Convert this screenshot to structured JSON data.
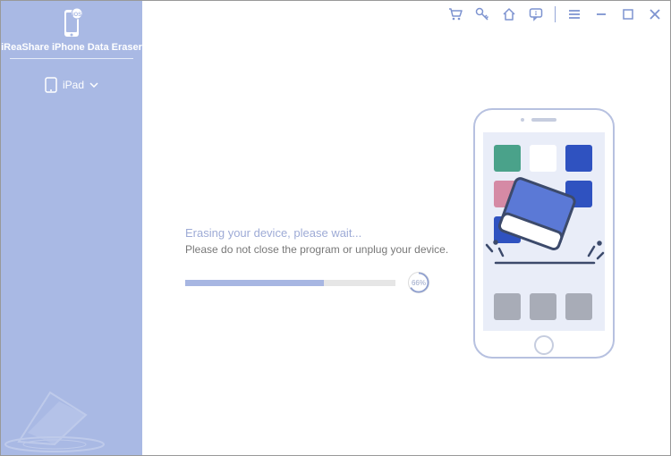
{
  "app": {
    "brand": "iReaShare iPhone Data Eraser"
  },
  "sidebar": {
    "device_label": "iPad"
  },
  "titlebar": {
    "icons": {
      "cart": "cart-icon",
      "key": "key-icon",
      "home": "home-icon",
      "feedback": "feedback-icon",
      "menu": "menu-icon",
      "minimize": "minimize-icon",
      "maximize": "maximize-icon",
      "close": "close-icon"
    }
  },
  "progress": {
    "status_title": "Erasing your device, please wait...",
    "status_warning": "Please do not close the program or unplug your device.",
    "percent_label": "66%",
    "percent_value": 66
  },
  "colors": {
    "sidebar": "#a9b9e4",
    "accent": "#4d69c8",
    "muted": "#9eabd6",
    "text": "#787878"
  }
}
